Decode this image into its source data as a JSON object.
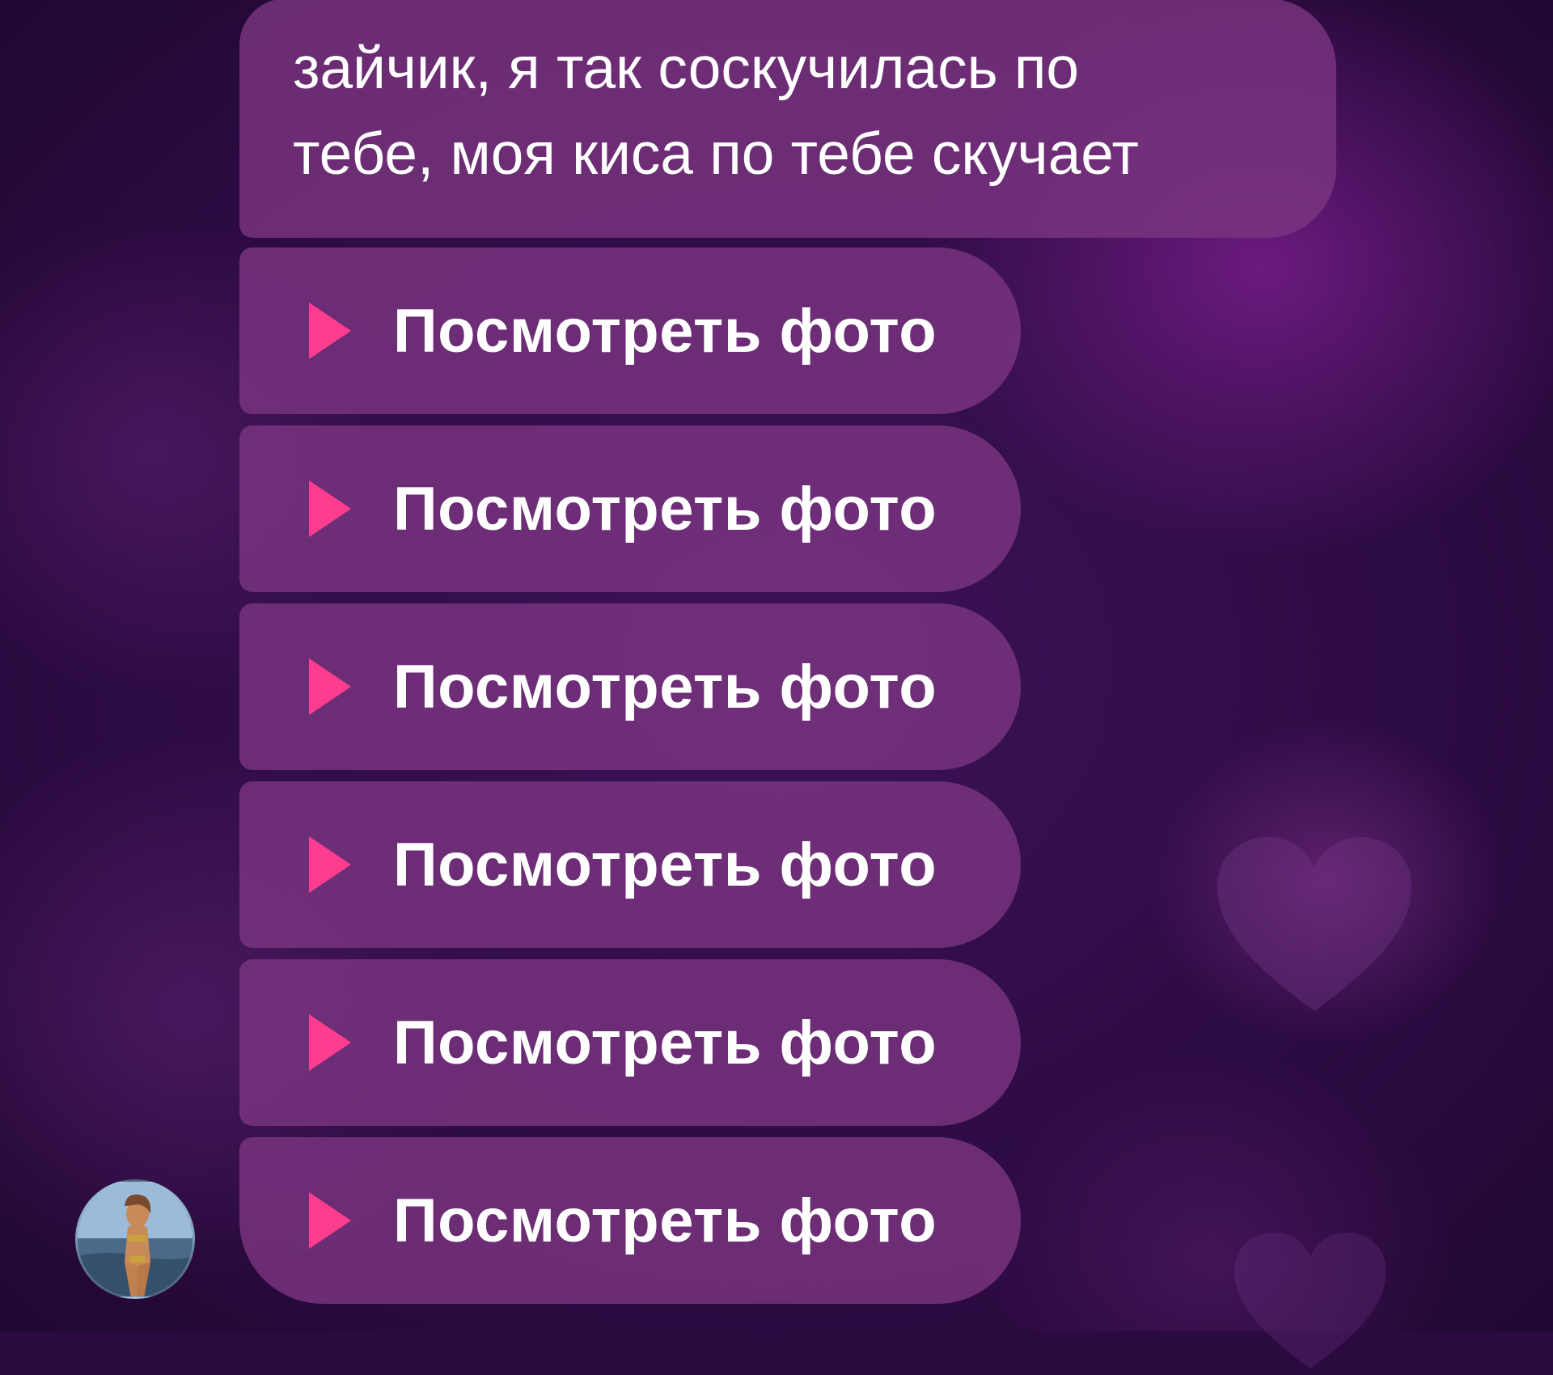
{
  "chat": {
    "message": {
      "line1": "зайчик, я так соскучилась по",
      "line2": "тебе, моя киса по тебе скучает"
    },
    "photo_buttons": [
      {
        "label": "Посмотреть фото",
        "icon": "play-icon"
      },
      {
        "label": "Посмотреть фото",
        "icon": "play-icon"
      },
      {
        "label": "Посмотреть фото",
        "icon": "play-icon"
      },
      {
        "label": "Посмотреть фото",
        "icon": "play-icon"
      },
      {
        "label": "Посмотреть фото",
        "icon": "play-icon"
      },
      {
        "label": "Посмотреть фото",
        "icon": "play-icon"
      }
    ],
    "sender_avatar": "avatar-image"
  },
  "colors": {
    "background": "#2a0a3f",
    "bubble": "#7a3480",
    "play_accent": "#ff3d8e",
    "text": "#ffffff"
  }
}
